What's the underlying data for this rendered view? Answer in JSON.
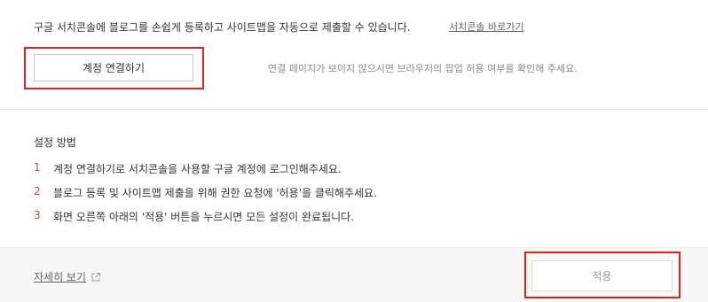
{
  "intro": {
    "text": "구글 서치콘솔에 블로그를 손쉽게 등록하고 사이트맵을 자동으로 제출할 수 있습니다.",
    "link_label": "서치콘솔 바로가기"
  },
  "connect": {
    "button_label": "계정 연결하기",
    "note": "연결 페이지가 보이지 않으시면 브라우저의 팝업 허용 여부를 확인해 주세요."
  },
  "guide": {
    "title": "설정 방법",
    "steps": [
      {
        "num": "1",
        "text": "계정 연결하기로 서치콘솔을 사용할 구글 계정에 로그인해주세요."
      },
      {
        "num": "2",
        "text": "블로그 등록 및 사이트맵 제출을 위해 권한 요청에 '허용'을 클릭해주세요."
      },
      {
        "num": "3",
        "text": "화면 오른쪽 아래의 '적용' 버튼을 누르시면 모든 설정이 완료됩니다."
      }
    ]
  },
  "footer": {
    "detail_label": "자세히 보기",
    "apply_label": "적용"
  },
  "colors": {
    "highlight": "#e0241c",
    "step_number": "#e0442c",
    "footer_bg": "#f7f7f8"
  }
}
